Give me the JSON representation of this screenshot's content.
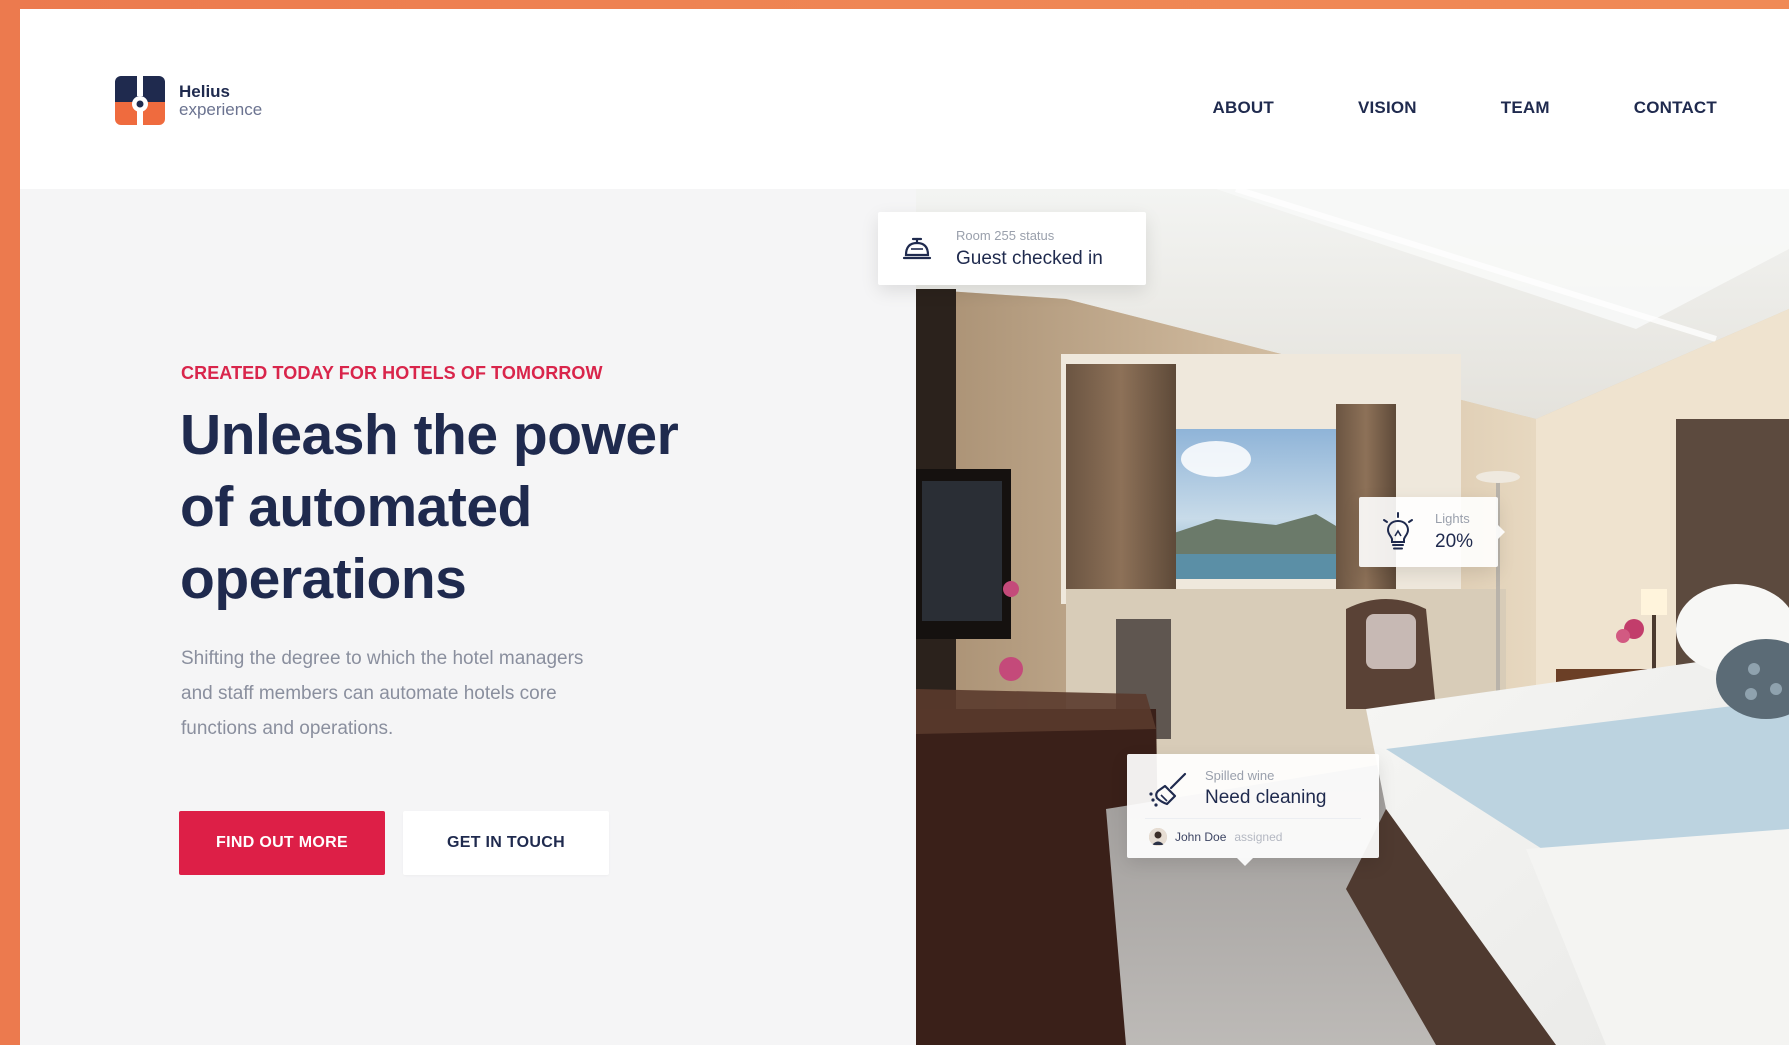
{
  "brand": {
    "name": "Helius",
    "subtitle": "experience",
    "colors": {
      "primary_navy": "#1f2a4e",
      "accent_red": "#dd1f47",
      "frame_orange": "#ec7a4e"
    }
  },
  "nav": {
    "items": [
      {
        "label": "ABOUT"
      },
      {
        "label": "VISION"
      },
      {
        "label": "TEAM"
      },
      {
        "label": "CONTACT"
      }
    ]
  },
  "hero": {
    "eyebrow": "CREATED TODAY FOR HOTELS OF TOMORROW",
    "headline_lines": [
      "Unleash the power",
      "of automated",
      "operations"
    ],
    "description_lines": [
      "Shifting the degree to which the hotel managers",
      "and staff members can automate hotels core",
      "functions and operations."
    ],
    "primary_button": "FIND OUT MORE",
    "secondary_button": "GET IN TOUCH"
  },
  "cards": {
    "room": {
      "icon": "service-bell-icon",
      "label": "Room 255 status",
      "value": "Guest checked in"
    },
    "lights": {
      "icon": "lightbulb-icon",
      "label": "Lights",
      "value": "20%"
    },
    "cleaning": {
      "icon": "broom-icon",
      "label": "Spilled wine",
      "value": "Need cleaning",
      "assignee_name": "John Doe",
      "assignee_status": "assigned"
    }
  }
}
